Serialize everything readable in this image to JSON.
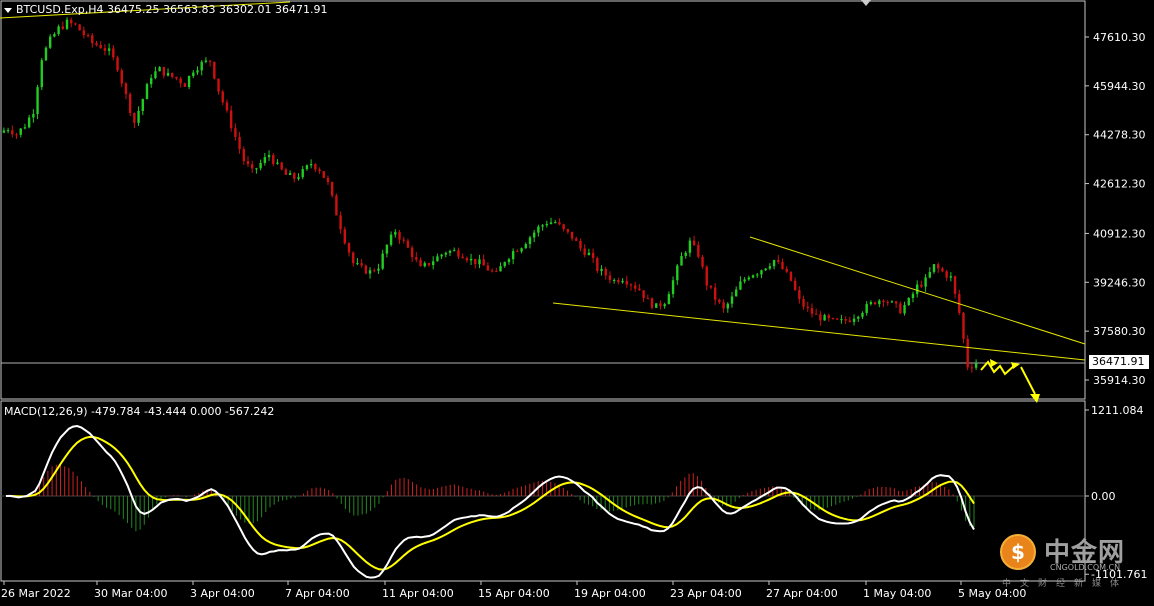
{
  "header": {
    "symbol_info": "BTCUSD.Exp,H4  36475.25 36563.83 36302.01 36471.91"
  },
  "macd_header": "MACD(12,26,9) -479.784 -43.444 0.000 -567.242",
  "current_price_label": "36471.91",
  "colors": {
    "background": "#000000",
    "bull_candle": "#22cc22",
    "bear_candle": "#cc1111",
    "trendline": "#e6e600",
    "macd_line": "#ffffff",
    "signal_line": "#ffff00",
    "hist_pos": "#cc2222",
    "hist_neg": "#228822",
    "arrow": "#ffff00",
    "bid_line": "#b0b0b0"
  },
  "logo": {
    "name": "中金网",
    "domain": "CNGOLD.COM.CN",
    "tagline": "中文财经新媒体"
  },
  "chart_data": {
    "type": "candlestick",
    "price_axis_ticks": [
      "47610.30",
      "45944.30",
      "44278.30",
      "42612.30",
      "40912.30",
      "39246.30",
      "37580.30",
      "35914.30"
    ],
    "price_axis_values": [
      47610.3,
      45944.3,
      44278.3,
      42612.3,
      40912.3,
      39246.3,
      37580.3,
      35914.3
    ],
    "time_axis_labels": [
      "26 Mar 2022",
      "30 Mar 04:00",
      "3 Apr 04:00",
      "7 Apr 04:00",
      "11 Apr 04:00",
      "15 Apr 04:00",
      "19 Apr 04:00",
      "23 Apr 04:00",
      "27 Apr 04:00",
      "1 May 04:00",
      "5 May 04:00"
    ],
    "macd_axis_ticks": [
      "1211.084",
      "0.00",
      "-1101.761"
    ],
    "macd_axis_values": [
      1211.084,
      0,
      -1101.761
    ],
    "close_path": [
      44500,
      44300,
      44600,
      45100,
      46900,
      47500,
      47900,
      48100,
      48000,
      47700,
      47400,
      47300,
      47100,
      46600,
      45600,
      44700,
      45500,
      46300,
      46500,
      46300,
      46200,
      46000,
      46500,
      46700,
      46800,
      45800,
      45000,
      44200,
      43400,
      43000,
      43300,
      43600,
      43200,
      42900,
      42800,
      43000,
      43300,
      43100,
      42600,
      41600,
      40700,
      39900,
      39700,
      39600,
      39800,
      40500,
      41000,
      40600,
      40200,
      39700,
      39900,
      40100,
      40300,
      40300,
      40200,
      40000,
      39900,
      39700,
      39500,
      40000,
      40300,
      40500,
      40800,
      41100,
      41300,
      41300,
      41000,
      40800,
      40400,
      40200,
      39700,
      39500,
      39300,
      39400,
      39200,
      39000,
      38600,
      38400,
      38600,
      39300,
      40100,
      40600,
      40200,
      39200,
      38700,
      38300,
      38700,
      39200,
      39500,
      39600,
      39800,
      40000,
      39700,
      39300,
      38600,
      38300,
      38100,
      38000,
      37900,
      37900,
      38000,
      38200,
      38400,
      38600,
      38700,
      38500,
      38300,
      38600,
      39100,
      39300,
      39800,
      39600,
      39400,
      38200,
      36400,
      36471.91
    ],
    "trendlines": [
      {
        "name": "upper",
        "from": {
          "date": "24 Apr",
          "price": 40900
        },
        "to": {
          "date": "6 May",
          "price": 37400
        }
      },
      {
        "name": "lower",
        "from": {
          "date": "18 Apr",
          "price": 38650
        },
        "to": {
          "date": "6 May",
          "price": 36550
        }
      }
    ]
  }
}
